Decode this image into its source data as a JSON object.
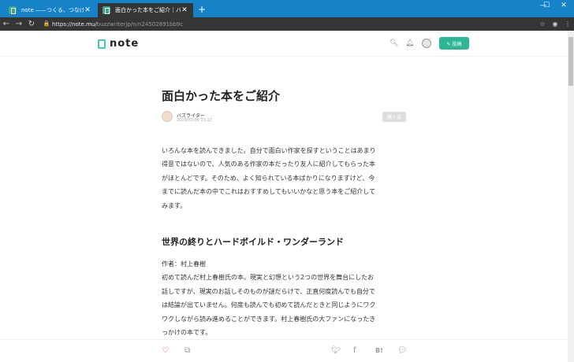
{
  "browser": {
    "tabs": [
      {
        "title": "note ——つくる、つなげる、とどける。",
        "active": false
      },
      {
        "title": "面白かった本をご紹介｜バズライター",
        "active": true
      }
    ],
    "new_tab_icon": "plus",
    "window_controls": {
      "minimize": "—",
      "maximize": "☐",
      "close": "✕"
    },
    "nav": {
      "back": "←",
      "forward": "→",
      "reload": "↻"
    },
    "url": {
      "host": "https://note.mu/",
      "path": "buzzwriterjp/n/n24502891bb9c"
    }
  },
  "site": {
    "logo_text": "note",
    "accent_color": "#2cb696",
    "post_button": "✎ 投稿"
  },
  "article": {
    "title": "面白かった本をご紹介",
    "author": "バズライター",
    "date": "2019/02/06 23:12",
    "buy_label": "購入済",
    "intro_lines": [
      "いろんな本を読んできました。自分で面白い作家を探すということはあまり",
      "得意ではないので、人気のある作家の本だったり友人に紹介してもらった本",
      "がほとんどです。そのため、よく知られている本ばかりになりますけど、今",
      "までに読んだ本の中でこれはおすすめしてもいいかなと思う本をご紹介して",
      "みます。"
    ],
    "section_heading": "世界の終りとハードボイルド・ワンダーランド",
    "section_lines": [
      "作者：村上春樹",
      "初めて読んだ村上春樹氏の本。現実と幻想という2つの世界を舞台にしたお",
      "話しですが、現実のお話しそのものが謎だらけで、正直何度読んでも自分で",
      "は結論が出ていません。何度も読んでも初めて読んだときと同じようにワク",
      "ワクしながら読み進めることができます。村上春樹氏の大ファンになったき",
      "っかけの本です。"
    ]
  },
  "action_bar": {
    "like_icon": "heart",
    "magazine_icon": "book",
    "share_icons": [
      "twitter",
      "facebook",
      "hatena-bookmark",
      "line"
    ]
  }
}
